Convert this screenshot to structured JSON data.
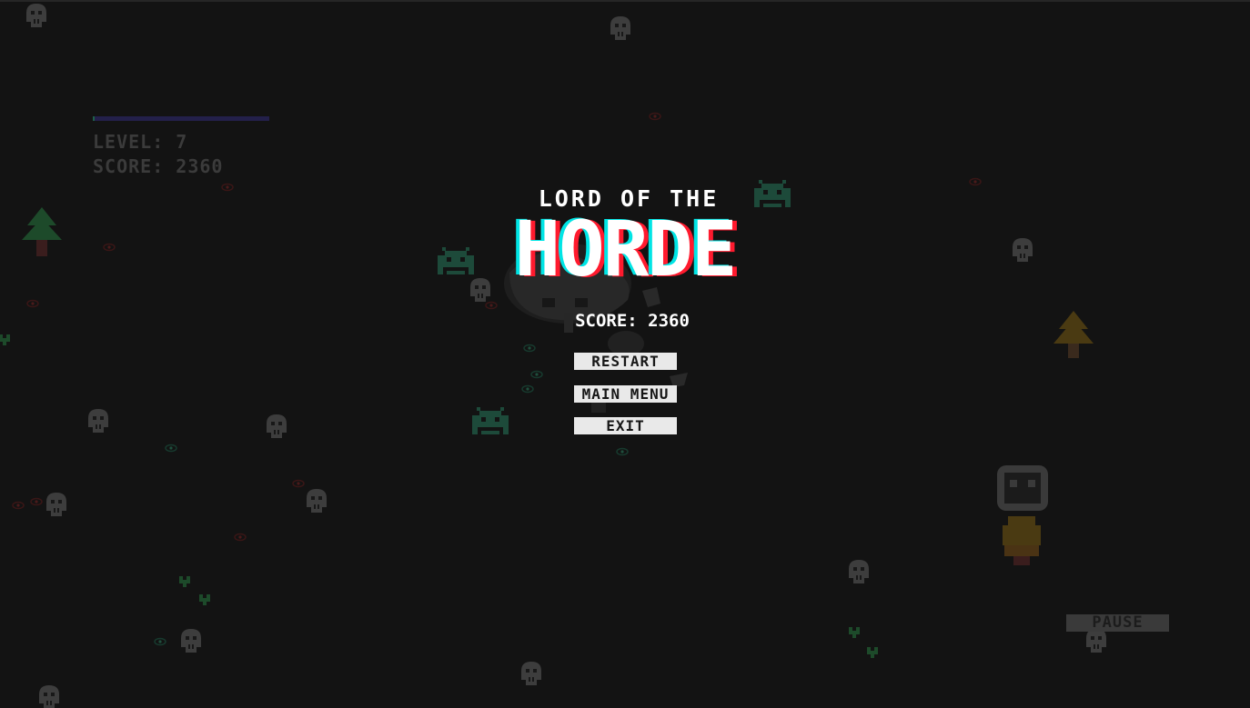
{
  "hud": {
    "level_text": "LEVEL: 7",
    "score_text": "SCORE: 2360",
    "xp_fraction": 0.01
  },
  "game_over": {
    "title_top": "LORD OF THE",
    "title_main": "HORDE",
    "score_text": "SCORE: 2360",
    "buttons": {
      "restart": "RESTART",
      "main_menu": "MAIN MENU",
      "exit": "EXIT"
    }
  },
  "pause_label": "PAUSE",
  "colors": {
    "background": "#131313",
    "title_cyan": "#00e5e5",
    "title_red": "#ff1a2e",
    "button_bg": "#e9e9e9",
    "enemy_green": "#1d4a3a",
    "tree_green": "#1d4a2a",
    "skull_gray": "#4a4a4a"
  }
}
